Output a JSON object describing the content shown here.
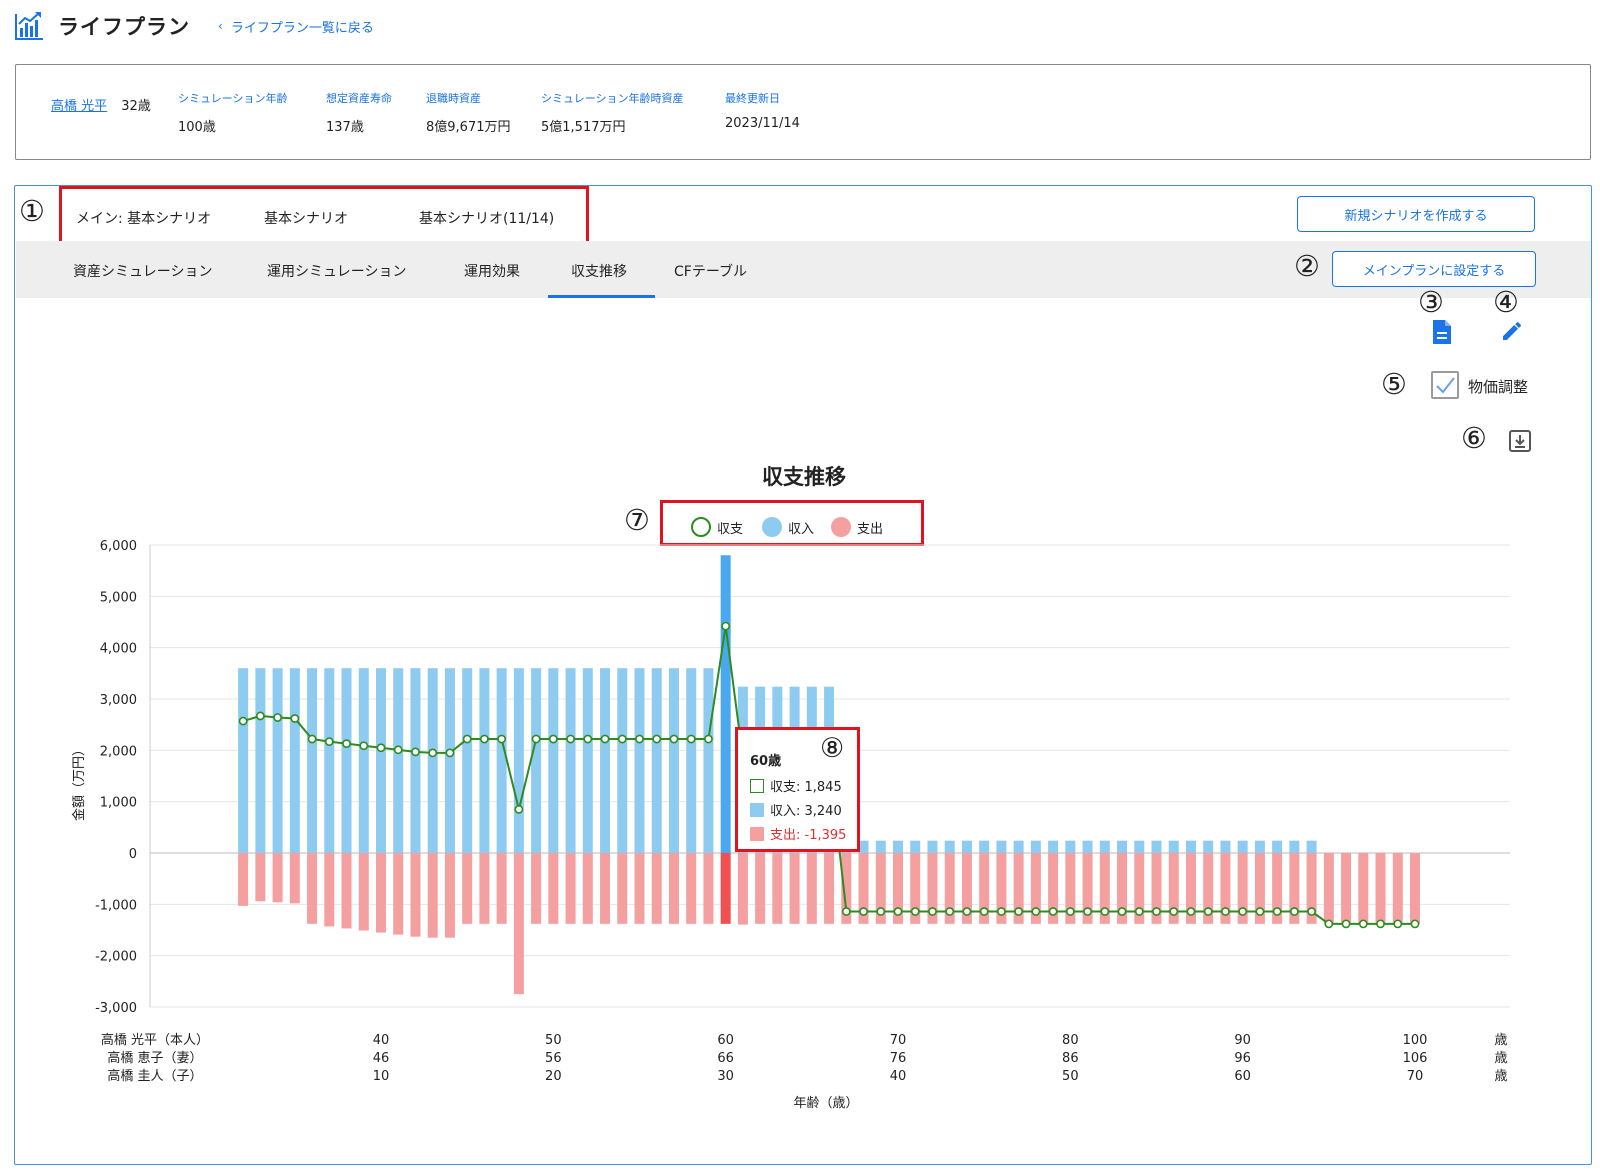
{
  "header": {
    "title": "ライフプラン",
    "back_link": "ライフプラン一覧に戻る"
  },
  "summary": {
    "person_name": "高橋 光平",
    "person_age": "32歳",
    "stats": [
      {
        "label": "シミュレーション年齢",
        "value": "100歳"
      },
      {
        "label": "想定資産寿命",
        "value": "137歳"
      },
      {
        "label": "退職時資産",
        "value": "8億9,671万円"
      },
      {
        "label": "シミュレーション年齢時資産",
        "value": "5億1,517万円"
      },
      {
        "label": "最終更新日",
        "value": "2023/11/14"
      }
    ]
  },
  "scenarios": {
    "main": "メイン: 基本シナリオ",
    "second": "基本シナリオ",
    "third": "基本シナリオ(11/14)"
  },
  "buttons": {
    "new_scenario": "新規シナリオを作成する",
    "set_main": "メインプランに設定する"
  },
  "tabs": [
    {
      "label": "資産シミュレーション"
    },
    {
      "label": "運用シミュレーション"
    },
    {
      "label": "運用効果"
    },
    {
      "label": "収支推移",
      "active": true
    },
    {
      "label": "CFテーブル"
    }
  ],
  "annotations": [
    "①",
    "②",
    "③",
    "④",
    "⑤",
    "⑥",
    "⑦",
    "⑧"
  ],
  "options": {
    "price_adjust_label": "物価調整",
    "price_adjust_checked": true
  },
  "icons": {
    "report": "document-icon",
    "edit": "pencil-icon",
    "download": "download-icon",
    "app": "chart-icon"
  },
  "colors": {
    "accent": "#1a73e8",
    "income": "#8ecbf0",
    "income_highlight": "#4aa8ef",
    "expense": "#f4a0a0",
    "expense_highlight": "#ef5050",
    "balance": "#2e8b1f",
    "highlight_box": "#e0141e"
  },
  "chart_data": {
    "type": "bar",
    "title": "収支推移",
    "ylabel": "金額（万円）",
    "xlabel": "年齢（歳）",
    "ylim": [
      -3000,
      6000
    ],
    "yticks": [
      "6,000",
      "5,000",
      "4,000",
      "3,000",
      "2,000",
      "1,000",
      "0",
      "-1,000",
      "-2,000",
      "-3,000"
    ],
    "ytick_values": [
      6000,
      5000,
      4000,
      3000,
      2000,
      1000,
      0,
      -1000,
      -2000,
      -3000
    ],
    "x_start_age": 32,
    "x_end_age": 100,
    "legend": [
      "収支",
      "収入",
      "支出"
    ],
    "series": [
      {
        "name": "収入",
        "type": "bar",
        "values": [
          3600,
          3600,
          3600,
          3600,
          3600,
          3600,
          3600,
          3600,
          3600,
          3600,
          3600,
          3600,
          3600,
          3600,
          3600,
          3600,
          3600,
          3600,
          3600,
          3600,
          3600,
          3600,
          3600,
          3600,
          3600,
          3600,
          3600,
          3600,
          5800,
          3240,
          3240,
          3240,
          3240,
          3240,
          3240,
          240,
          240,
          240,
          240,
          240,
          240,
          240,
          240,
          240,
          240,
          240,
          240,
          240,
          240,
          240,
          240,
          240,
          240,
          240,
          240,
          240,
          240,
          240,
          240,
          240,
          240,
          240,
          240,
          0,
          0,
          0,
          0,
          0,
          0
        ]
      },
      {
        "name": "支出",
        "type": "bar",
        "values": [
          -1030,
          -940,
          -960,
          -980,
          -1380,
          -1430,
          -1470,
          -1510,
          -1550,
          -1590,
          -1630,
          -1650,
          -1650,
          -1380,
          -1380,
          -1380,
          -2750,
          -1380,
          -1380,
          -1380,
          -1380,
          -1380,
          -1380,
          -1380,
          -1380,
          -1380,
          -1380,
          -1380,
          -1380,
          -1395,
          -1380,
          -1380,
          -1380,
          -1380,
          -1380,
          -1380,
          -1380,
          -1380,
          -1380,
          -1380,
          -1380,
          -1380,
          -1380,
          -1380,
          -1380,
          -1380,
          -1380,
          -1380,
          -1380,
          -1380,
          -1380,
          -1380,
          -1380,
          -1380,
          -1380,
          -1380,
          -1380,
          -1380,
          -1380,
          -1380,
          -1380,
          -1380,
          -1380,
          -1380,
          -1380,
          -1380,
          -1380,
          -1380,
          -1380
        ]
      },
      {
        "name": "収支",
        "type": "line",
        "values": [
          2570,
          2670,
          2640,
          2620,
          2220,
          2170,
          2130,
          2090,
          2050,
          2010,
          1970,
          1950,
          1950,
          2220,
          2220,
          2220,
          850,
          2220,
          2220,
          2220,
          2220,
          2220,
          2220,
          2220,
          2220,
          2220,
          2220,
          2220,
          4420,
          1845,
          1860,
          1860,
          1860,
          1860,
          1860,
          -1140,
          -1140,
          -1140,
          -1140,
          -1140,
          -1140,
          -1140,
          -1140,
          -1140,
          -1140,
          -1140,
          -1140,
          -1140,
          -1140,
          -1140,
          -1140,
          -1140,
          -1140,
          -1140,
          -1140,
          -1140,
          -1140,
          -1140,
          -1140,
          -1140,
          -1140,
          -1140,
          -1140,
          -1380,
          -1380,
          -1380,
          -1380,
          -1380,
          -1380
        ]
      }
    ],
    "x_axis_rows": [
      {
        "label": "高橋 光平（本人）",
        "ticks": [
          "40",
          "50",
          "60",
          "70",
          "80",
          "90",
          "100"
        ],
        "unit": "歳"
      },
      {
        "label": "高橋 恵子（妻）",
        "ticks": [
          "46",
          "56",
          "66",
          "76",
          "86",
          "96",
          "106"
        ],
        "unit": "歳"
      },
      {
        "label": "高橋 圭人（子）",
        "ticks": [
          "10",
          "20",
          "30",
          "40",
          "50",
          "60",
          "70"
        ],
        "unit": "歳"
      }
    ],
    "x_tick_ages": [
      40,
      50,
      60,
      70,
      80,
      90,
      100
    ],
    "highlighted_age": 60,
    "tooltip": {
      "title": "60歳",
      "balance": "収支: 1,845",
      "income": "収入: 3,240",
      "expense": "支出: -1,395"
    }
  }
}
